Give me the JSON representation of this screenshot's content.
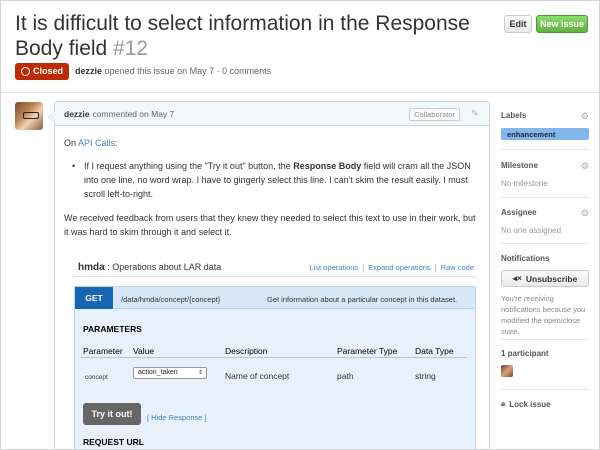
{
  "issue": {
    "title": "It is difficult to select information in the Response Body field",
    "number": "#12",
    "state": "Closed",
    "author": "dezzie",
    "opened_text": "opened this issue on May 7 · 0 comments"
  },
  "header_buttons": {
    "edit": "Edit",
    "new_issue": "New issue"
  },
  "comment": {
    "author": "dezzie",
    "commented_text": "commented on May 7",
    "badge": "Collaborator",
    "intro_prefix": "On ",
    "intro_link": "API Calls",
    "intro_suffix": ":",
    "bullet_part1": "If I request anything using the \"Try it out\" button, the ",
    "bullet_bold": "Response Body",
    "bullet_part2": " field will cram all the JSON into one line, no word wrap. I have to gingerly select this line. I can't skim the result easily. I must scroll left-to-right.",
    "paragraph2": "We received feedback from users that they knew they needed to select this text to use in their work, but it was hard to skim through it and select it."
  },
  "api": {
    "name": "hmda",
    "subtitle": ": Operations about LAR data",
    "links": [
      "List operations",
      "Expand operations",
      "Raw code"
    ],
    "method": "GET",
    "path": "/data/hmda/concept/{concept}",
    "description": "Get information about a particular concept in this dataset.",
    "params_title": "PARAMETERS",
    "columns": [
      "Parameter",
      "Value",
      "Description",
      "Parameter Type",
      "Data Type"
    ],
    "row": {
      "parameter": "concept",
      "value": "action_taken",
      "description": "Name of concept",
      "param_type": "path",
      "data_type": "string"
    },
    "try_button": "Try it out!",
    "hide_response": "[ Hide Response ]",
    "request_url": "REQUEST URL"
  },
  "sidebar": {
    "labels_title": "Labels",
    "label": "enhancement",
    "milestone_title": "Milestone",
    "milestone_value": "No milestone",
    "assignee_title": "Assignee",
    "assignee_value": "No one assigned",
    "notifications_title": "Notifications",
    "unsubscribe": "Unsubscribe",
    "notif_text": "You're receiving notifications because you modified the open/close state.",
    "participants": "1 participant",
    "lock": "Lock issue"
  },
  "colors": {
    "closed": "#bd2c00",
    "new_issue": "#60b044",
    "link": "#4183c4",
    "get_method": "#1766b3",
    "label_enhancement": "#84b6eb"
  }
}
